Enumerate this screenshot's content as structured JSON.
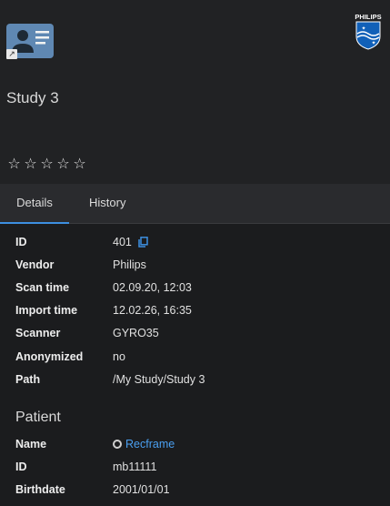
{
  "study": {
    "title": "Study 3",
    "icon": "contact-card-icon",
    "shortcut_icon": "shortcut-arrow-icon",
    "logo_text": "PHILIPS",
    "stars": [
      "☆",
      "☆",
      "☆",
      "☆",
      "☆"
    ],
    "rating": 0
  },
  "tabs": [
    {
      "label": "Details",
      "active": true
    },
    {
      "label": "History",
      "active": false
    }
  ],
  "details": {
    "id_label": "ID",
    "id_value": "401",
    "vendor_label": "Vendor",
    "vendor_value": "Philips",
    "scan_time_label": "Scan time",
    "scan_time_value": "02.09.20, 12:03",
    "import_time_label": "Import time",
    "import_time_value": "12.02.26, 16:35",
    "scanner_label": "Scanner",
    "scanner_value": "GYRO35",
    "anonymized_label": "Anonymized",
    "anonymized_value": "no",
    "path_label": "Path",
    "path_value": "/My Study/Study 3"
  },
  "patient": {
    "heading": "Patient",
    "name_label": "Name",
    "name_value": "Recframe",
    "id_label": "ID",
    "id_value": "mb11111",
    "birthdate_label": "Birthdate",
    "birthdate_value": "2001/01/01"
  },
  "colors": {
    "accent": "#3d8fe0",
    "link": "#4a9ff0",
    "icon_bg": "#5f88b3",
    "logo": "#1160b8"
  }
}
